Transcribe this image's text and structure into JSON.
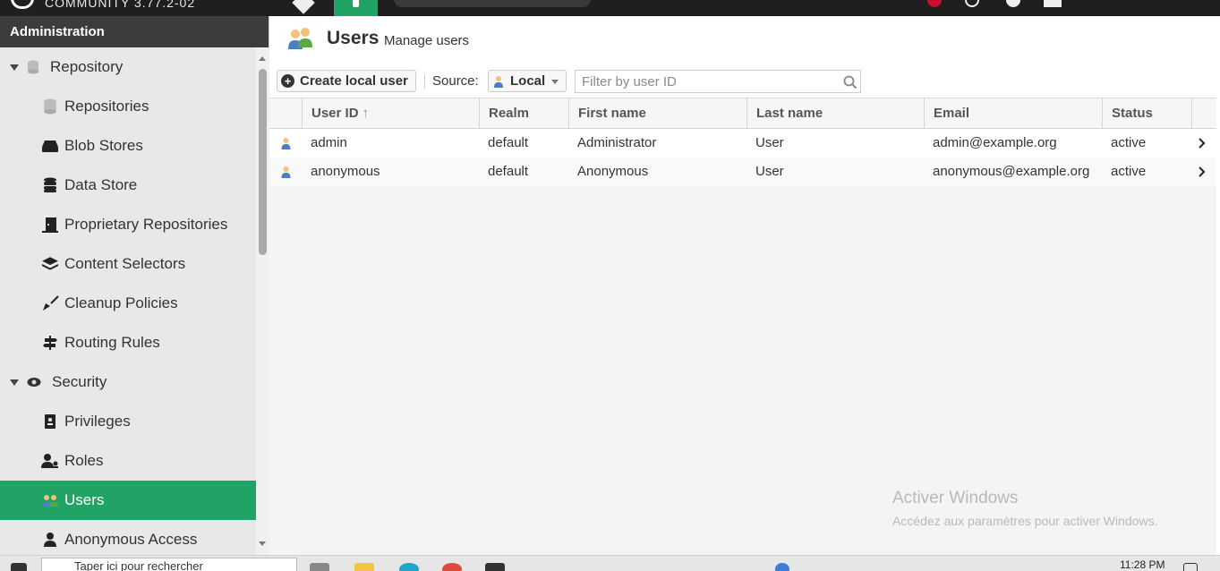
{
  "topbar": {
    "brand": "COMMUNITY 3.77.2-02"
  },
  "sidebar": {
    "header": "Administration",
    "groups": [
      {
        "label": "Repository",
        "icon": "database-icon"
      },
      {
        "label": "Security",
        "icon": "eye-icon"
      }
    ],
    "repository_items": [
      {
        "label": "Repositories",
        "icon": "database-icon"
      },
      {
        "label": "Blob Stores",
        "icon": "hard-drive-icon"
      },
      {
        "label": "Data Store",
        "icon": "data-store-icon"
      },
      {
        "label": "Proprietary Repositories",
        "icon": "door-icon"
      },
      {
        "label": "Content Selectors",
        "icon": "layers-icon"
      },
      {
        "label": "Cleanup Policies",
        "icon": "broom-icon"
      },
      {
        "label": "Routing Rules",
        "icon": "signpost-icon"
      }
    ],
    "security_items": [
      {
        "label": "Privileges",
        "icon": "badge-icon"
      },
      {
        "label": "Roles",
        "icon": "user-key-icon"
      },
      {
        "label": "Users",
        "icon": "users-icon",
        "active": true
      },
      {
        "label": "Anonymous Access",
        "icon": "user-icon"
      }
    ]
  },
  "page": {
    "title": "Users",
    "subtitle": "Manage users"
  },
  "toolbar": {
    "create_label": "Create local user",
    "source_label": "Source:",
    "source_value": "Local",
    "filter_placeholder": "Filter by user ID"
  },
  "table": {
    "columns": [
      "User ID",
      "Realm",
      "First name",
      "Last name",
      "Email",
      "Status"
    ],
    "sort_indicator": "↑",
    "rows": [
      {
        "user_id": "admin",
        "realm": "default",
        "first_name": "Administrator",
        "last_name": "User",
        "email": "admin@example.org",
        "status": "active"
      },
      {
        "user_id": "anonymous",
        "realm": "default",
        "first_name": "Anonymous",
        "last_name": "User",
        "email": "anonymous@example.org",
        "status": "active"
      }
    ]
  },
  "watermark": {
    "line1": "Activer Windows",
    "line2": "Accédez aux paramètres pour activer Windows."
  },
  "taskbar": {
    "search_text": "Taper ici pour rechercher",
    "time": "11:28 PM"
  },
  "colors": {
    "accent": "#21a366",
    "topbar": "#1f1f1f",
    "sidebar_header": "#3c3c3c"
  }
}
